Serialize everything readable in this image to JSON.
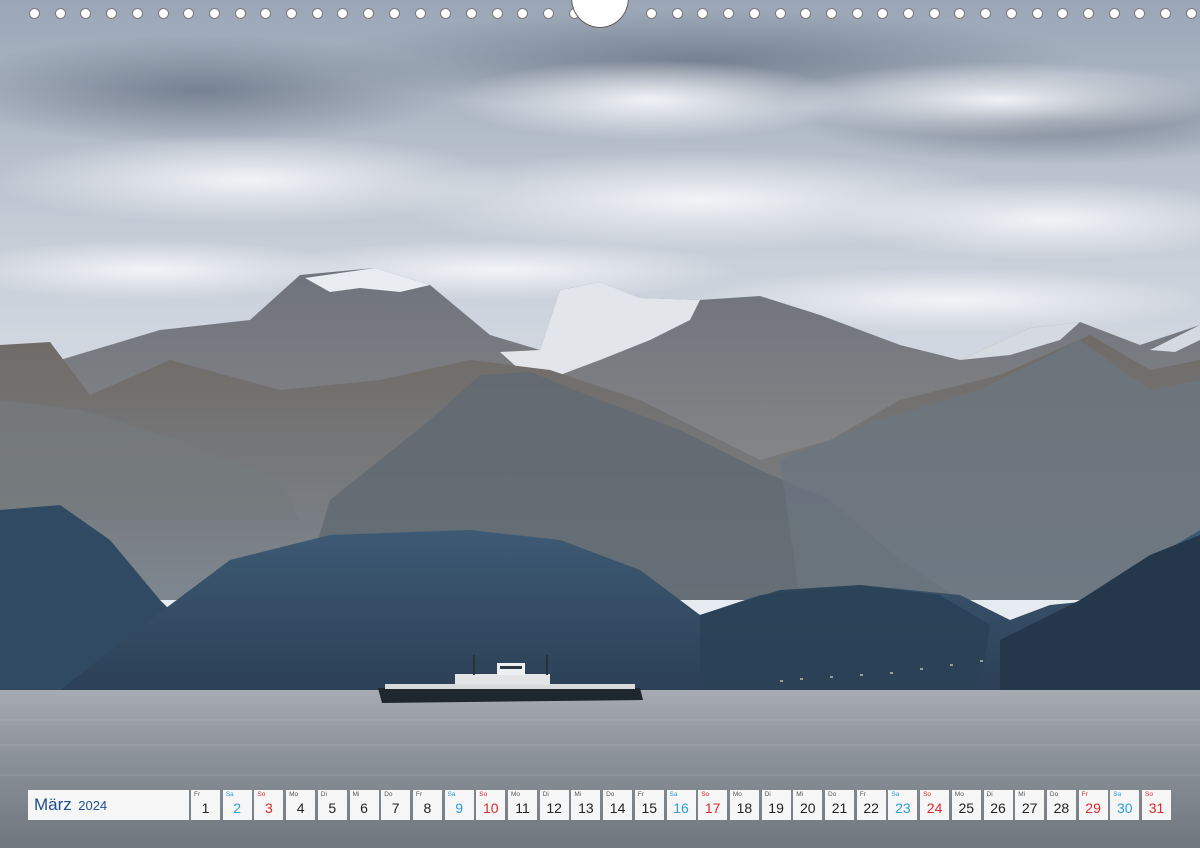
{
  "calendar": {
    "month": "März",
    "year": "2024",
    "days": [
      {
        "wd": "Fr",
        "num": "1",
        "type": "weekday"
      },
      {
        "wd": "Sa",
        "num": "2",
        "type": "sat"
      },
      {
        "wd": "So",
        "num": "3",
        "type": "sun"
      },
      {
        "wd": "Mo",
        "num": "4",
        "type": "weekday"
      },
      {
        "wd": "Di",
        "num": "5",
        "type": "weekday"
      },
      {
        "wd": "Mi",
        "num": "6",
        "type": "weekday"
      },
      {
        "wd": "Do",
        "num": "7",
        "type": "weekday"
      },
      {
        "wd": "Fr",
        "num": "8",
        "type": "weekday"
      },
      {
        "wd": "Sa",
        "num": "9",
        "type": "sat"
      },
      {
        "wd": "So",
        "num": "10",
        "type": "sun"
      },
      {
        "wd": "Mo",
        "num": "11",
        "type": "weekday"
      },
      {
        "wd": "Di",
        "num": "12",
        "type": "weekday"
      },
      {
        "wd": "Mi",
        "num": "13",
        "type": "weekday"
      },
      {
        "wd": "Do",
        "num": "14",
        "type": "weekday"
      },
      {
        "wd": "Fr",
        "num": "15",
        "type": "weekday"
      },
      {
        "wd": "Sa",
        "num": "16",
        "type": "sat"
      },
      {
        "wd": "So",
        "num": "17",
        "type": "sun"
      },
      {
        "wd": "Mo",
        "num": "18",
        "type": "weekday"
      },
      {
        "wd": "Di",
        "num": "19",
        "type": "weekday"
      },
      {
        "wd": "Mi",
        "num": "20",
        "type": "weekday"
      },
      {
        "wd": "Do",
        "num": "21",
        "type": "weekday"
      },
      {
        "wd": "Fr",
        "num": "22",
        "type": "weekday"
      },
      {
        "wd": "Sa",
        "num": "23",
        "type": "sat"
      },
      {
        "wd": "So",
        "num": "24",
        "type": "sun"
      },
      {
        "wd": "Mo",
        "num": "25",
        "type": "weekday"
      },
      {
        "wd": "Di",
        "num": "26",
        "type": "weekday"
      },
      {
        "wd": "Mi",
        "num": "27",
        "type": "weekday"
      },
      {
        "wd": "Do",
        "num": "28",
        "type": "weekday"
      },
      {
        "wd": "Fr",
        "num": "29",
        "type": "sun"
      },
      {
        "wd": "Sa",
        "num": "30",
        "type": "sat"
      },
      {
        "wd": "So",
        "num": "31",
        "type": "sun"
      }
    ]
  },
  "colors": {
    "weekday_text": "#222222",
    "saturday_text": "#2a9fd9",
    "sunday_holiday_text": "#d8292f",
    "month_text": "#1f4e8a",
    "fjord_water": "#8f959b",
    "sky_cloud": "#d7dde4"
  },
  "photo": {
    "subject_icons": [
      "mountain-range-icon",
      "snow-peak-icon",
      "fjord-icon",
      "ferry-icon",
      "cloud-icon"
    ]
  }
}
